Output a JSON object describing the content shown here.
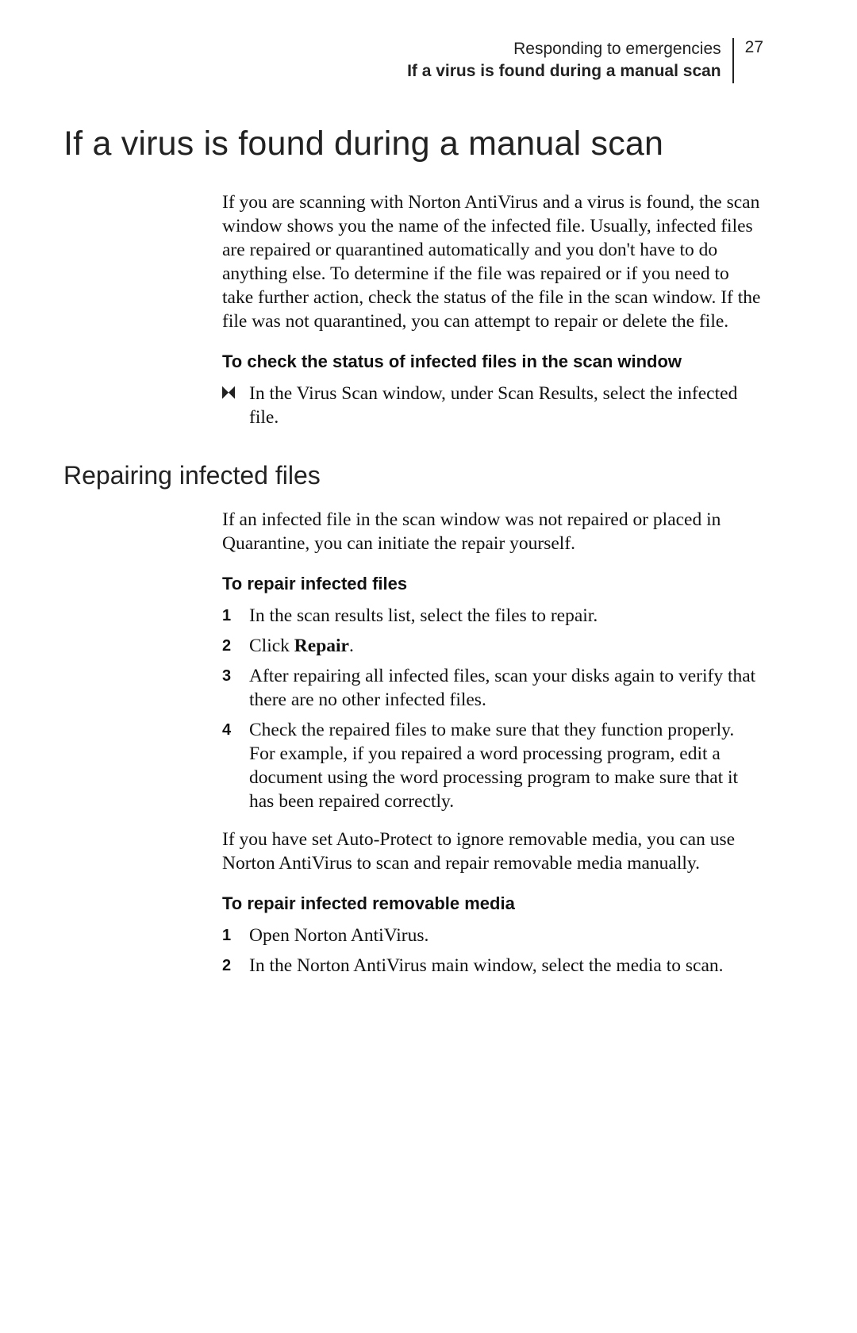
{
  "runhead": {
    "chapter": "Responding to emergencies",
    "section": "If a virus is found during a manual scan",
    "page_number": "27"
  },
  "title": "If a virus is found during a manual scan",
  "intro_para": "If you are scanning with Norton AntiVirus and a virus is found, the scan window shows you the name of the infected file. Usually, infected files are repaired or quarantined automatically and you don't have to do anything else. To determine if the file was repaired or if you need to take further action, check the status of the file in the scan window. If the file was not quarantined, you can attempt to repair or delete the file.",
  "proc1_head": "To check the status of infected files in the scan window",
  "proc1_bullet": "In the Virus Scan window, under Scan Results, select the infected file.",
  "h2": "Repairing infected files",
  "repair_intro": "If an infected file in the scan window was not repaired or placed in Quarantine, you can initiate the repair yourself.",
  "proc2_head": "To repair infected files",
  "proc2_steps": {
    "s1": "In the scan results list, select the files to repair.",
    "s2_a": "Click ",
    "s2_b": "Repair",
    "s2_c": ".",
    "s3": "After repairing all infected files, scan your disks again to verify that there are no other infected files.",
    "s4a": "Check the repaired files to make sure that they function properly.",
    "s4b": "For example, if you repaired a word processing program, edit a document using the word processing program to make sure that it has been repaired correctly."
  },
  "removable_para": "If you have set Auto-Protect to ignore removable media, you can use Norton AntiVirus to scan and repair removable media manually.",
  "proc3_head": "To repair infected removable media",
  "proc3_steps": {
    "s1": "Open Norton AntiVirus.",
    "s2": "In the Norton AntiVirus main window, select the media to scan."
  }
}
